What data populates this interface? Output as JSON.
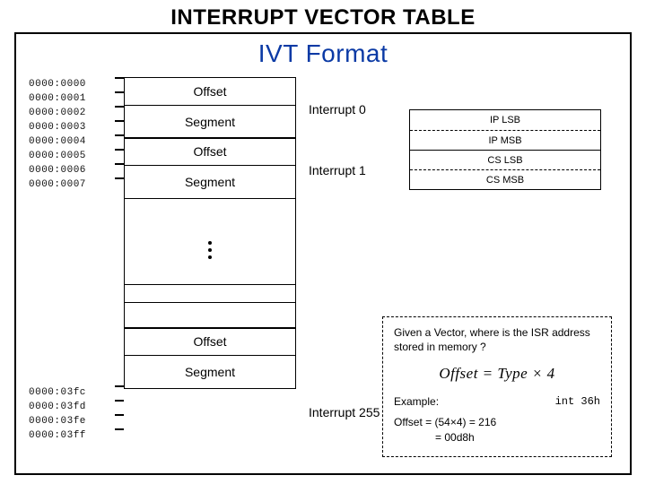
{
  "title": "INTERRUPT VECTOR TABLE",
  "subtitle": "IVT Format",
  "addresses_top": [
    "0000:0000",
    "0000:0001",
    "0000:0002",
    "0000:0003",
    "0000:0004",
    "0000:0005",
    "0000:0006",
    "0000:0007"
  ],
  "addresses_bot": [
    "0000:03fc",
    "0000:03fd",
    "0000:03fe",
    "0000:03ff"
  ],
  "cell_offset": "Offset",
  "cell_segment": "Segment",
  "int0": "Interrupt 0",
  "int1": "Interrupt 1",
  "int255": "Interrupt 255",
  "bytes": {
    "ip_lsb": "IP LSB",
    "ip_msb": "IP MSB",
    "cs_lsb": "CS LSB",
    "cs_msb": "CS MSB"
  },
  "formula": {
    "q": "Given a Vector, where is the ISR address stored in memory ?",
    "eq": "Offset = Type × 4",
    "example_label": "Example:",
    "example_code": "int 36h",
    "result_l1": "Offset = (54×4) = 216",
    "result_l2": "= 00d8h"
  }
}
